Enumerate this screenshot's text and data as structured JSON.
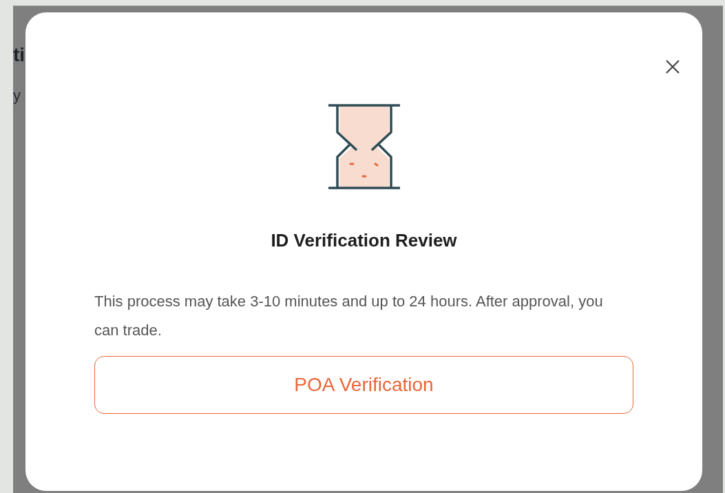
{
  "background": {
    "texts": [
      "ti",
      "y"
    ]
  },
  "dialog": {
    "title": "ID Verification Review",
    "message": "This process may take 3-10 minutes and up to 24 hours. After approval, you can trade.",
    "button": "POA Verification"
  }
}
